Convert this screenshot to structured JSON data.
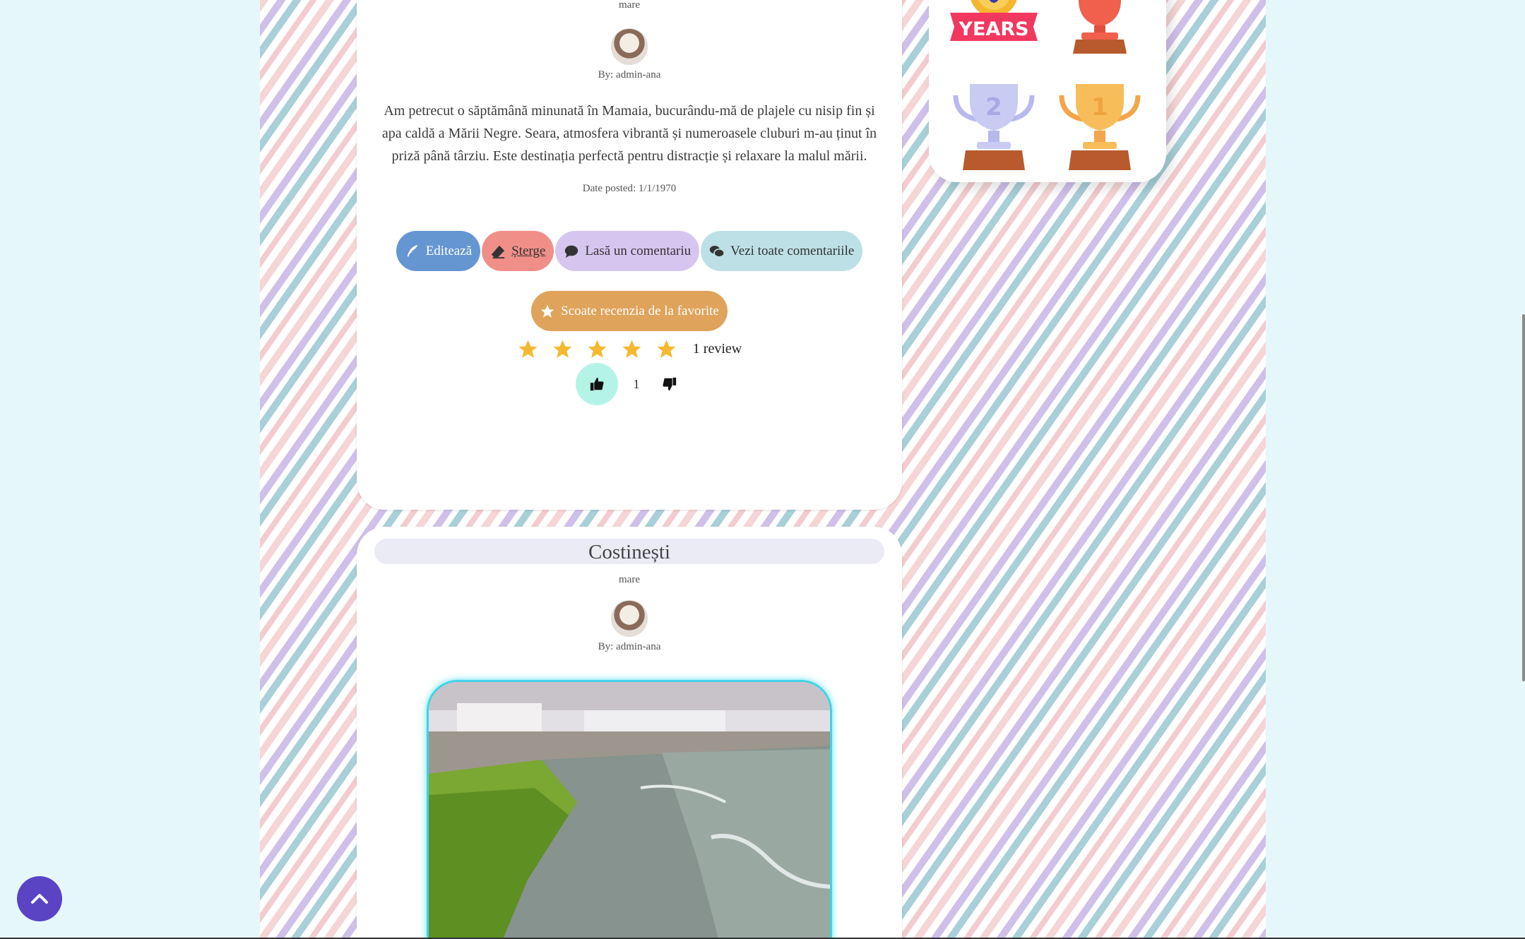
{
  "review1": {
    "category": "mare",
    "author": "By: admin-ana",
    "text": "Am petrecut o săptămână minunată în Mamaia, bucurându-mă de plajele cu nisip fin și apa caldă a Mării Negre. Seara, atmosfera vibrantă și numeroasele cluburi m-au ținut în priză până târziu. Este destinația perfectă pentru distracție și relaxare la malul mării.",
    "date": "Date posted: 1/1/1970",
    "buttons": {
      "edit": "Editează",
      "delete": "Șterge",
      "comment": "Lasă un comentariu",
      "all_comments": "Vezi toate comentariile",
      "favorite": "Scoate recenzia de la favorite"
    },
    "rating": 5,
    "review_count": "1 review",
    "likes": "1"
  },
  "review2": {
    "title": "Costinești",
    "category": "mare",
    "author": "By: admin-ana"
  },
  "widget": {
    "badge_text": "YEARS"
  },
  "colors": {
    "edit": "#6596d2",
    "delete": "#f08f88",
    "comment": "#d6c6ef",
    "all_comments": "#bde0e6",
    "favorite": "#e0a35b",
    "star": "#f5b82e",
    "like_bg": "#b4f4e6",
    "scroll_top": "#5a44c4"
  }
}
